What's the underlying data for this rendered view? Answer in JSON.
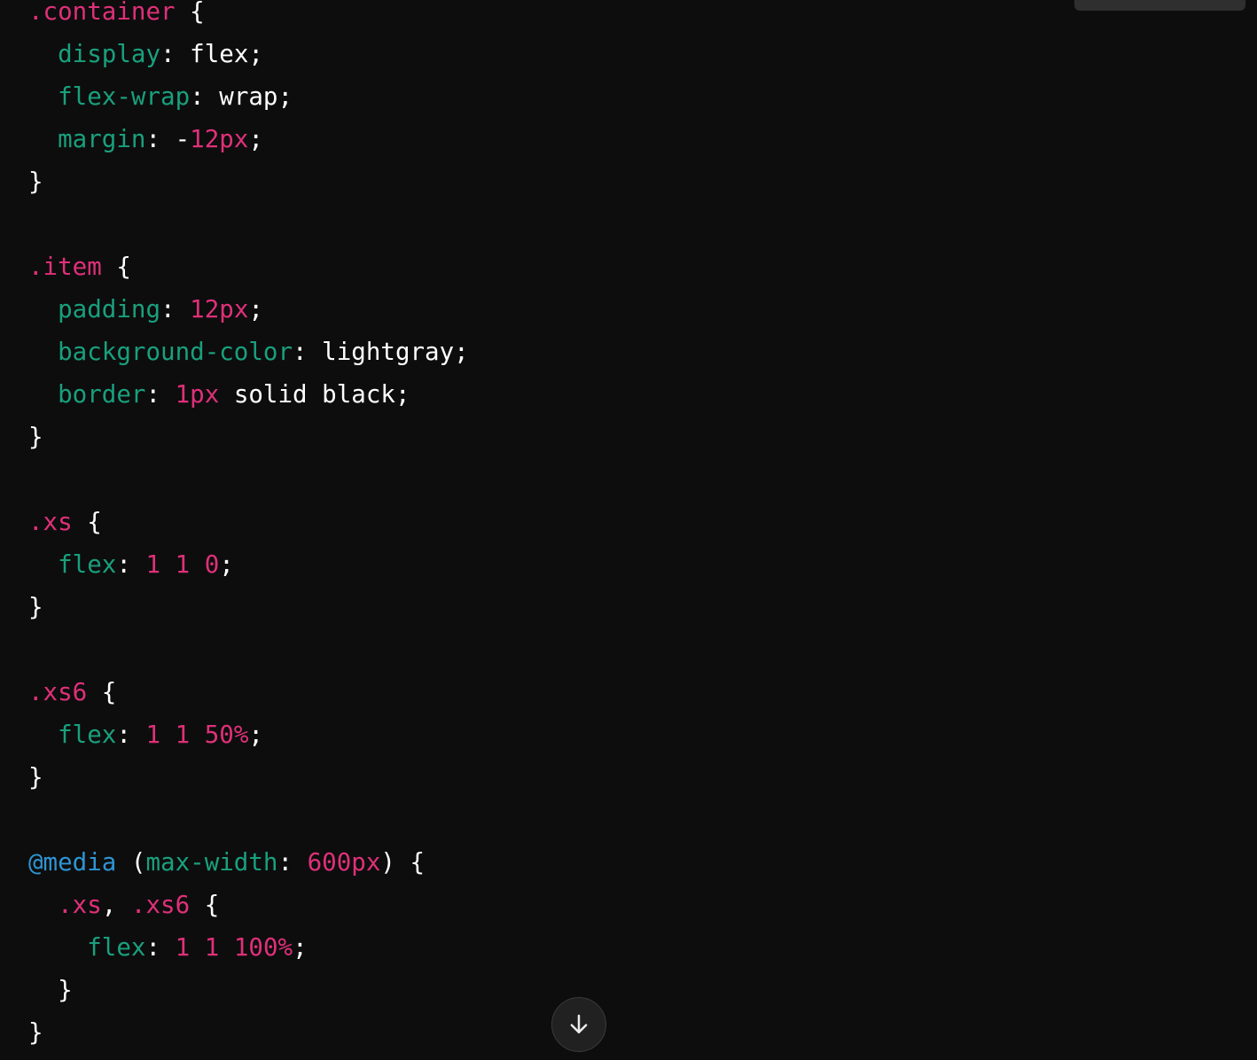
{
  "code_block": {
    "language": "css",
    "lines": [
      [
        {
          "t": "sel",
          "v": ".container"
        },
        {
          "t": "pun",
          "v": " {"
        }
      ],
      [
        {
          "t": "pun",
          "v": "  "
        },
        {
          "t": "prop",
          "v": "display"
        },
        {
          "t": "pun",
          "v": ": "
        },
        {
          "t": "val",
          "v": "flex"
        },
        {
          "t": "pun",
          "v": ";"
        }
      ],
      [
        {
          "t": "pun",
          "v": "  "
        },
        {
          "t": "prop",
          "v": "flex-wrap"
        },
        {
          "t": "pun",
          "v": ": "
        },
        {
          "t": "val",
          "v": "wrap"
        },
        {
          "t": "pun",
          "v": ";"
        }
      ],
      [
        {
          "t": "pun",
          "v": "  "
        },
        {
          "t": "prop",
          "v": "margin"
        },
        {
          "t": "pun",
          "v": ": -"
        },
        {
          "t": "num",
          "v": "12px"
        },
        {
          "t": "pun",
          "v": ";"
        }
      ],
      [
        {
          "t": "pun",
          "v": "}"
        }
      ],
      [],
      [
        {
          "t": "sel",
          "v": ".item"
        },
        {
          "t": "pun",
          "v": " {"
        }
      ],
      [
        {
          "t": "pun",
          "v": "  "
        },
        {
          "t": "prop",
          "v": "padding"
        },
        {
          "t": "pun",
          "v": ": "
        },
        {
          "t": "num",
          "v": "12px"
        },
        {
          "t": "pun",
          "v": ";"
        }
      ],
      [
        {
          "t": "pun",
          "v": "  "
        },
        {
          "t": "prop",
          "v": "background-color"
        },
        {
          "t": "pun",
          "v": ": "
        },
        {
          "t": "val",
          "v": "lightgray"
        },
        {
          "t": "pun",
          "v": ";"
        }
      ],
      [
        {
          "t": "pun",
          "v": "  "
        },
        {
          "t": "prop",
          "v": "border"
        },
        {
          "t": "pun",
          "v": ": "
        },
        {
          "t": "num",
          "v": "1px"
        },
        {
          "t": "val",
          "v": " solid black"
        },
        {
          "t": "pun",
          "v": ";"
        }
      ],
      [
        {
          "t": "pun",
          "v": "}"
        }
      ],
      [],
      [
        {
          "t": "sel",
          "v": ".xs"
        },
        {
          "t": "pun",
          "v": " {"
        }
      ],
      [
        {
          "t": "pun",
          "v": "  "
        },
        {
          "t": "prop",
          "v": "flex"
        },
        {
          "t": "pun",
          "v": ": "
        },
        {
          "t": "num",
          "v": "1"
        },
        {
          "t": "pun",
          "v": " "
        },
        {
          "t": "num",
          "v": "1"
        },
        {
          "t": "pun",
          "v": " "
        },
        {
          "t": "num",
          "v": "0"
        },
        {
          "t": "pun",
          "v": ";"
        }
      ],
      [
        {
          "t": "pun",
          "v": "}"
        }
      ],
      [],
      [
        {
          "t": "sel",
          "v": ".xs6"
        },
        {
          "t": "pun",
          "v": " {"
        }
      ],
      [
        {
          "t": "pun",
          "v": "  "
        },
        {
          "t": "prop",
          "v": "flex"
        },
        {
          "t": "pun",
          "v": ": "
        },
        {
          "t": "num",
          "v": "1"
        },
        {
          "t": "pun",
          "v": " "
        },
        {
          "t": "num",
          "v": "1"
        },
        {
          "t": "pun",
          "v": " "
        },
        {
          "t": "num",
          "v": "50%"
        },
        {
          "t": "pun",
          "v": ";"
        }
      ],
      [
        {
          "t": "pun",
          "v": "}"
        }
      ],
      [],
      [
        {
          "t": "at",
          "v": "@media"
        },
        {
          "t": "pun",
          "v": " ("
        },
        {
          "t": "prop",
          "v": "max-width"
        },
        {
          "t": "pun",
          "v": ": "
        },
        {
          "t": "num",
          "v": "600px"
        },
        {
          "t": "pun",
          "v": ") {"
        }
      ],
      [
        {
          "t": "pun",
          "v": "  "
        },
        {
          "t": "sel",
          "v": ".xs"
        },
        {
          "t": "pun",
          "v": ", "
        },
        {
          "t": "sel",
          "v": ".xs6"
        },
        {
          "t": "pun",
          "v": " {"
        }
      ],
      [
        {
          "t": "pun",
          "v": "    "
        },
        {
          "t": "prop",
          "v": "flex"
        },
        {
          "t": "pun",
          "v": ": "
        },
        {
          "t": "num",
          "v": "1"
        },
        {
          "t": "pun",
          "v": " "
        },
        {
          "t": "num",
          "v": "1"
        },
        {
          "t": "pun",
          "v": " "
        },
        {
          "t": "num",
          "v": "100%"
        },
        {
          "t": "pun",
          "v": ";"
        }
      ],
      [
        {
          "t": "pun",
          "v": "  }"
        }
      ],
      [
        {
          "t": "pun",
          "v": "}"
        }
      ]
    ]
  },
  "colors": {
    "background": "#0d0d0d",
    "selector": "#df3079",
    "property": "#19a07d",
    "number": "#df3079",
    "at_rule": "#2e95d3",
    "plain": "#ffffff"
  },
  "icons": {
    "copy": "copy-icon",
    "scroll_down": "arrow-down-icon"
  }
}
